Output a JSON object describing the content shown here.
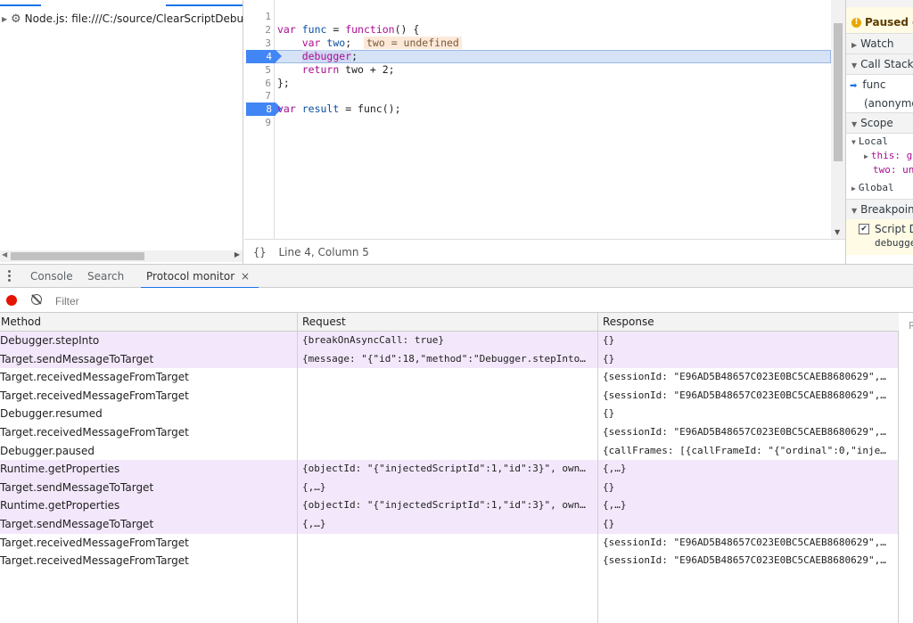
{
  "navigator": {
    "tree_item": "Node.js: file:///C:/source/ClearScriptDebugg"
  },
  "editor": {
    "line_numbers": [
      "1",
      "2",
      "3",
      "4",
      "5",
      "6",
      "7",
      "8",
      "9"
    ],
    "breakpoint_lines": [
      4,
      8
    ],
    "current_line": 4,
    "code": {
      "l2_kw": "var",
      "l2_name": "func",
      "l2_rest1": " = ",
      "l2_kw2": "function",
      "l2_rest2": "() {",
      "l3_kw": "var",
      "l3_name": "two",
      "l3_rest": ";",
      "l3_inline_value": "two = undefined",
      "l4_kw": "debugger",
      "l4_rest": ";",
      "l5_kw": "return",
      "l5_rest": " two + 2;",
      "l6": "};",
      "l8_kw": "var",
      "l8_name": "result",
      "l8_rest": " = func();"
    }
  },
  "status_bar": {
    "braces": "{}",
    "position": "Line 4, Column 5"
  },
  "sidebar": {
    "paused_text": "Paused o",
    "watch": "Watch",
    "call_stack": "Call Stack",
    "frames": [
      "func",
      "(anonymo"
    ],
    "scope": "Scope",
    "local": "Local",
    "this_label": "this: g",
    "two_label": "two: un",
    "global": "Global",
    "breakpoints": "Breakpoint",
    "bp_item1": "Script D",
    "bp_item1b": "debugge"
  },
  "drawer": {
    "tabs": [
      "Console",
      "Search",
      "Protocol monitor"
    ],
    "active_tab": "Protocol monitor",
    "close_symbol": "×",
    "filter_placeholder": "Filter",
    "record_color": "#e51400"
  },
  "table": {
    "columns": [
      "Method",
      "Request",
      "Response"
    ],
    "rows": [
      {
        "method": "Debugger.stepInto",
        "request": "{breakOnAsyncCall: true}",
        "response": "{}",
        "selected": true
      },
      {
        "method": "Target.sendMessageToTarget",
        "request": "{message: \"{\"id\":18,\"method\":\"Debugger.stepInto…",
        "response": "{}",
        "selected": true
      },
      {
        "method": "Target.receivedMessageFromTarget",
        "request": "",
        "response": "{sessionId: \"E96AD5B48657C023E0BC5CAEB8680629\",…",
        "selected": false
      },
      {
        "method": "Target.receivedMessageFromTarget",
        "request": "",
        "response": "{sessionId: \"E96AD5B48657C023E0BC5CAEB8680629\",…",
        "selected": false
      },
      {
        "method": "Debugger.resumed",
        "request": "",
        "response": "{}",
        "selected": false
      },
      {
        "method": "Target.receivedMessageFromTarget",
        "request": "",
        "response": "{sessionId: \"E96AD5B48657C023E0BC5CAEB8680629\",…",
        "selected": false
      },
      {
        "method": "Debugger.paused",
        "request": "",
        "response": "{callFrames: [{callFrameId: \"{\"ordinal\":0,\"inje…",
        "selected": false
      },
      {
        "method": "Runtime.getProperties",
        "request": "{objectId: \"{\"injectedScriptId\":1,\"id\":3}\", own…",
        "response": "{,…}",
        "selected": true
      },
      {
        "method": "Target.sendMessageToTarget",
        "request": "{,…}",
        "response": "{}",
        "selected": true
      },
      {
        "method": "Runtime.getProperties",
        "request": "{objectId: \"{\"injectedScriptId\":1,\"id\":3}\", own…",
        "response": "{,…}",
        "selected": true
      },
      {
        "method": "Target.sendMessageToTarget",
        "request": "{,…}",
        "response": "{}",
        "selected": true
      },
      {
        "method": "Target.receivedMessageFromTarget",
        "request": "",
        "response": "{sessionId: \"E96AD5B48657C023E0BC5CAEB8680629\",…",
        "selected": false
      },
      {
        "method": "Target.receivedMessageFromTarget",
        "request": "",
        "response": "{sessionId: \"E96AD5B48657C023E0BC5CAEB8680629\",…",
        "selected": false
      }
    ]
  },
  "side_panel_letter": "R"
}
